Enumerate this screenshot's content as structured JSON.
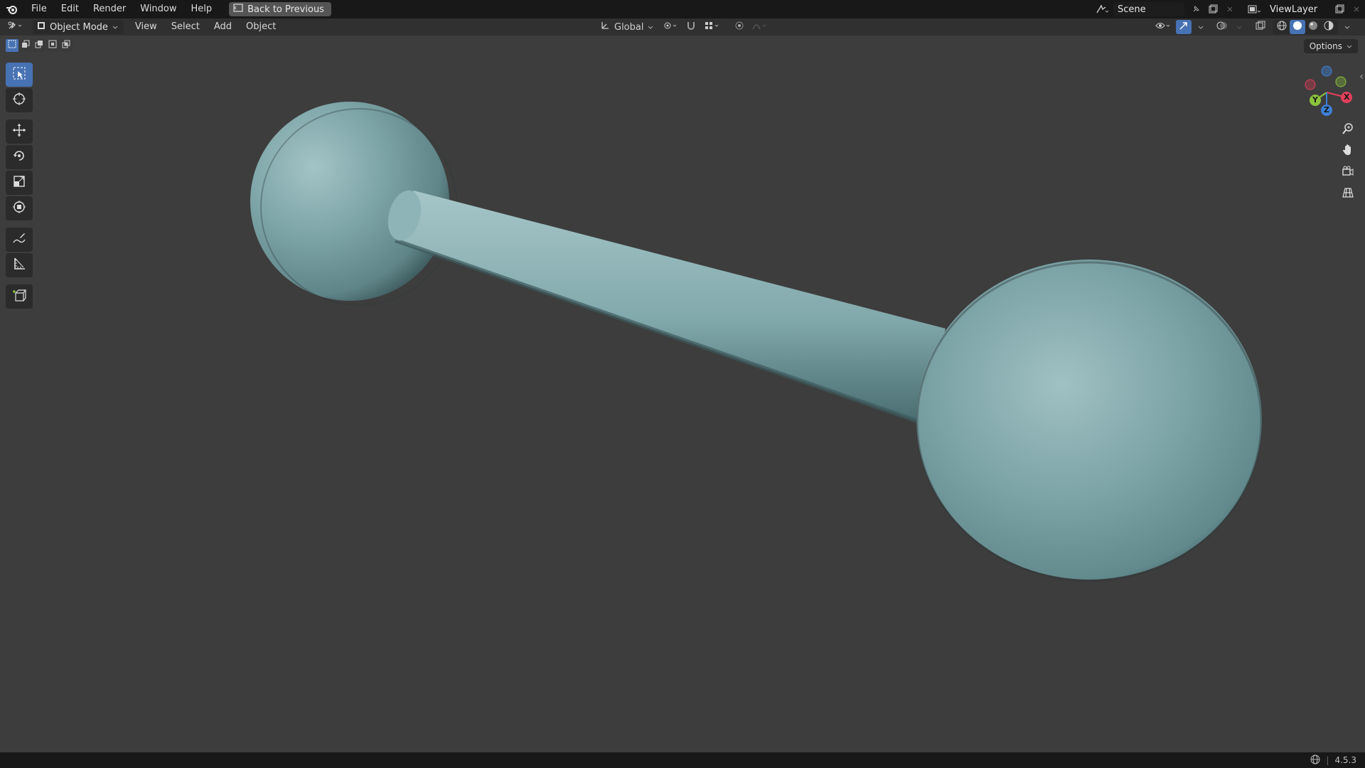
{
  "topbar": {
    "menus": [
      "File",
      "Edit",
      "Render",
      "Window",
      "Help"
    ],
    "back_label": "Back to Previous",
    "scene_label": "Scene",
    "viewlayer_label": "ViewLayer"
  },
  "header": {
    "mode_label": "Object Mode",
    "menus": [
      "View",
      "Select",
      "Add",
      "Object"
    ],
    "transform_orientation": "Global",
    "options_label": "Options"
  },
  "status": {
    "version": "4.5.3"
  },
  "colors": {
    "viewport_bg": "#3d3d3d",
    "object_color": "#7ba3a6",
    "accent": "#4772b3",
    "axis_x": "#e23f5b",
    "axis_y": "#8bc33c",
    "axis_z": "#3d80d5"
  },
  "gizmo": {
    "x_label": "X",
    "y_label": "Y",
    "z_label": "Z"
  },
  "icons": {
    "tools": [
      "select-box-icon",
      "cursor-icon",
      "move-icon",
      "rotate-icon",
      "scale-icon",
      "transform-icon",
      "annotate-icon",
      "measure-icon",
      "add-cube-icon"
    ],
    "nav": [
      "zoom-icon",
      "pan-hand-icon",
      "camera-icon",
      "perspective-grid-icon"
    ]
  }
}
